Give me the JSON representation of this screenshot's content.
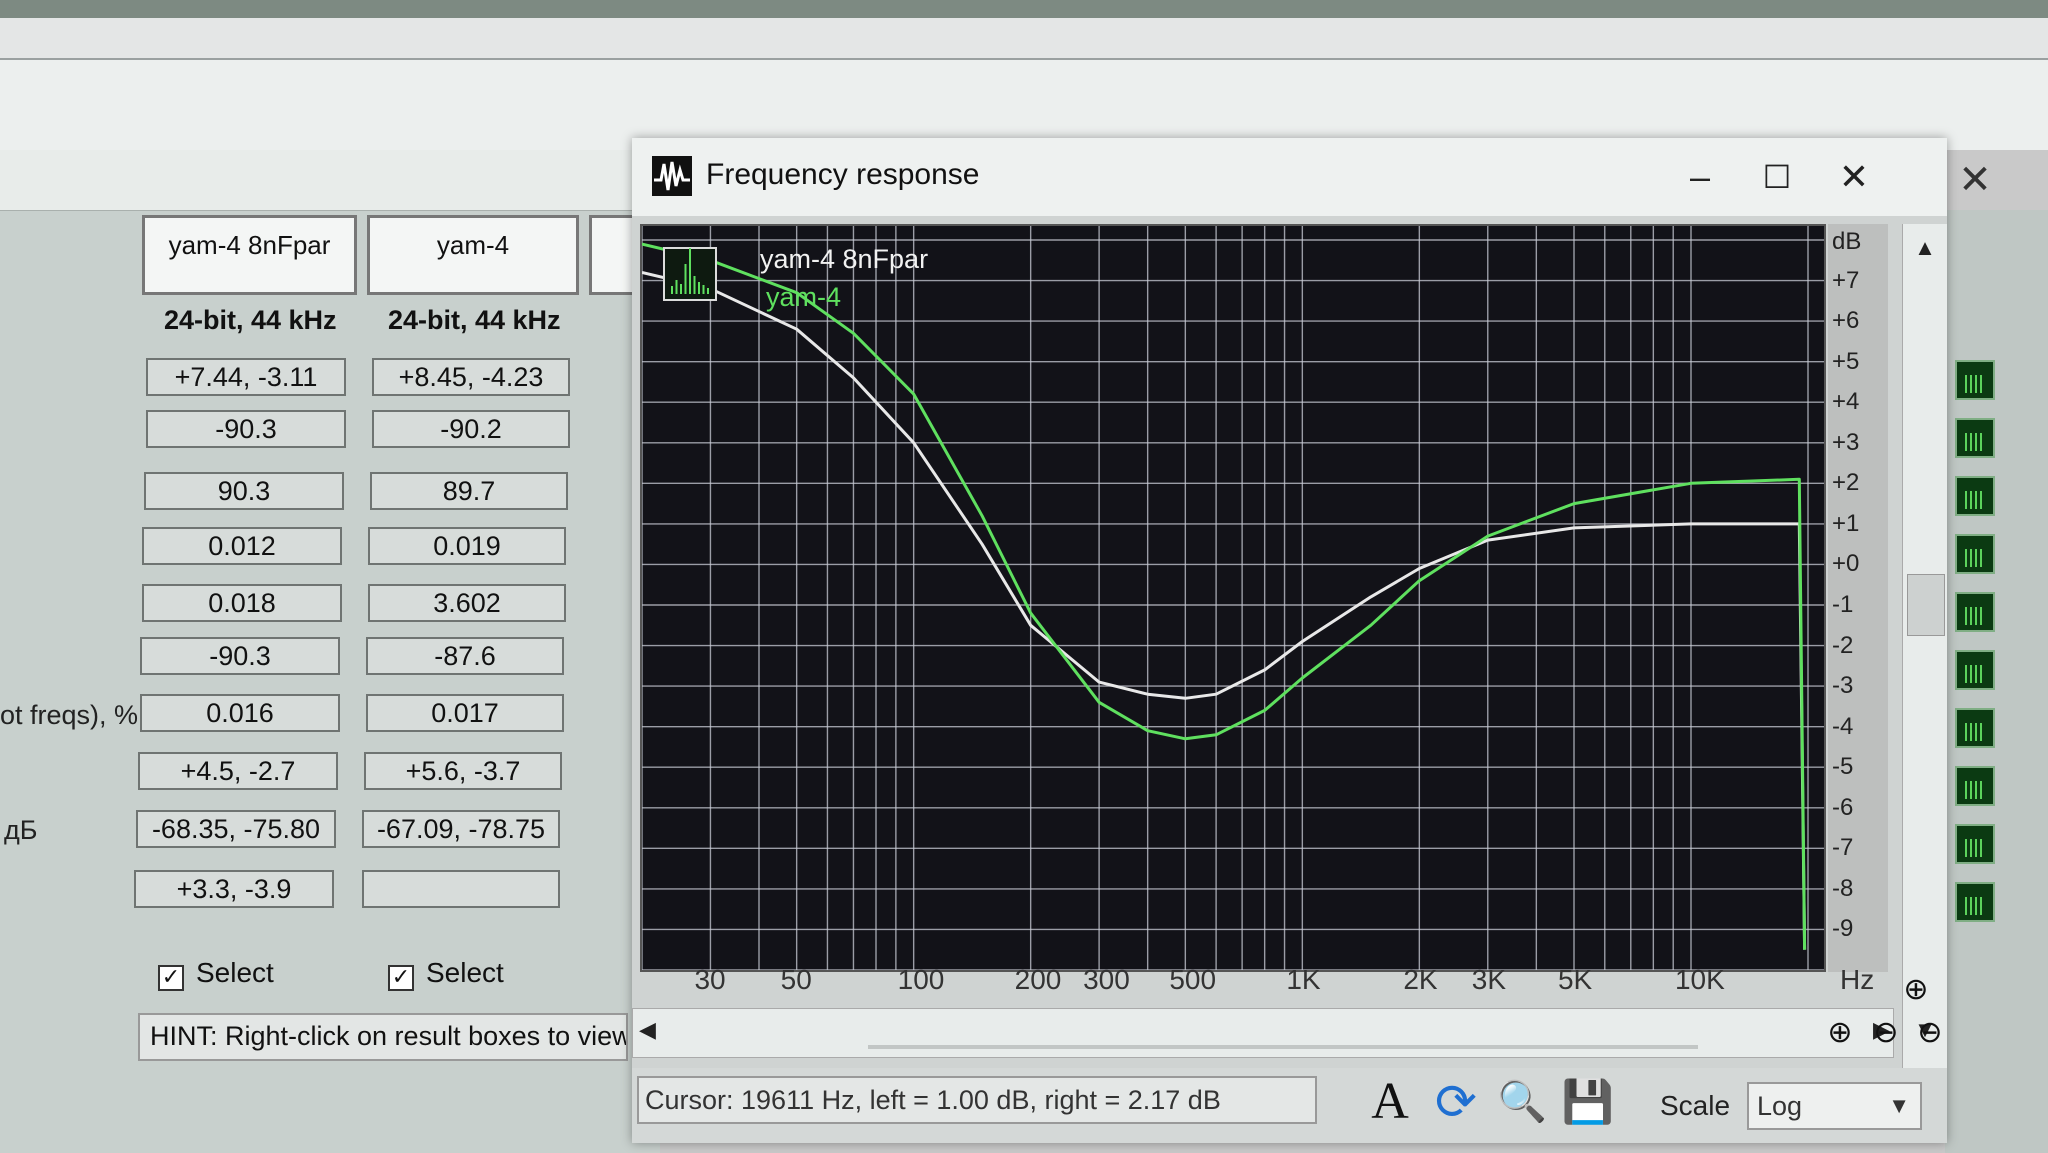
{
  "window": {
    "title": "Frequency response",
    "minimize_glyph": "–",
    "maximize_glyph": "☐",
    "close_glyph": "✕"
  },
  "plot": {
    "legend": [
      "yam-4 8nFpar",
      "yam-4"
    ],
    "db_unit": "dB",
    "db_ticks": [
      "+7",
      "+6",
      "+5",
      "+4",
      "+3",
      "+2",
      "+1",
      "+0",
      "-1",
      "-2",
      "-3",
      "-4",
      "-5",
      "-6",
      "-7",
      "-8",
      "-9"
    ],
    "x_ticks": [
      "30",
      "50",
      "100",
      "200",
      "300",
      "500",
      "1K",
      "2K",
      "3K",
      "5K",
      "10K"
    ],
    "x_unit": "Hz"
  },
  "chart_data": {
    "type": "line",
    "title": "",
    "xlabel": "Hz",
    "ylabel": "dB",
    "xscale": "log",
    "xlim": [
      20,
      20000
    ],
    "ylim": [
      -10,
      8
    ],
    "grid": true,
    "legend_placement": "top-left",
    "series": [
      {
        "name": "yam-4 8nFpar",
        "color": "#e8e8e8",
        "x": [
          20,
          30,
          50,
          70,
          100,
          150,
          200,
          300,
          400,
          500,
          600,
          800,
          1000,
          1500,
          2000,
          3000,
          5000,
          10000,
          19000,
          19600
        ],
        "y": [
          7.2,
          6.8,
          5.8,
          4.6,
          3.0,
          0.5,
          -1.5,
          -2.9,
          -3.2,
          -3.3,
          -3.2,
          -2.6,
          -1.9,
          -0.8,
          -0.1,
          0.6,
          0.9,
          1.0,
          1.0,
          -9.5
        ]
      },
      {
        "name": "yam-4",
        "color": "#5fe05f",
        "x": [
          20,
          30,
          50,
          70,
          100,
          150,
          200,
          300,
          400,
          500,
          600,
          800,
          1000,
          1500,
          2000,
          3000,
          5000,
          10000,
          19000,
          19600
        ],
        "y": [
          7.9,
          7.5,
          6.7,
          5.7,
          4.2,
          1.2,
          -1.2,
          -3.4,
          -4.1,
          -4.3,
          -4.2,
          -3.6,
          -2.8,
          -1.5,
          -0.4,
          0.7,
          1.5,
          2.0,
          2.1,
          -9.5
        ]
      }
    ]
  },
  "status": {
    "cursor": "Cursor:  19611 Hz,  left = 1.00 dB,  right = 2.17 dB",
    "scale_label": "Scale",
    "scale_value": "Log"
  },
  "toolbar": {
    "text_icon": "A",
    "refresh_icon": "⟳",
    "magnifier_icon": "🔍",
    "save_icon": "💾",
    "zoom_in_glyph": "⊕",
    "zoom_out_glyph": "⊖"
  },
  "background": {
    "columns": [
      {
        "name": "yam-4 8nFpar",
        "format": "24-bit, 44 kHz",
        "values": [
          "+7.44, -3.11",
          "-90.3",
          "90.3",
          "0.012",
          "0.018",
          "-90.3",
          "0.016",
          "+4.5, -2.7",
          "-68.35, -75.80",
          "+3.3, -3.9"
        ]
      },
      {
        "name": "yam-4",
        "format": "24-bit, 44 kHz",
        "values": [
          "+8.45, -4.23",
          "-90.2",
          "89.7",
          "0.019",
          "3.602",
          "-87.6",
          "0.017",
          "+5.6, -3.7",
          "-67.09, -78.75",
          ""
        ]
      }
    ],
    "row_label_a": "ot freqs), %",
    "row_label_b": "дБ",
    "select_label": "Select",
    "hint": "HINT: Right-click on result boxes to view"
  }
}
